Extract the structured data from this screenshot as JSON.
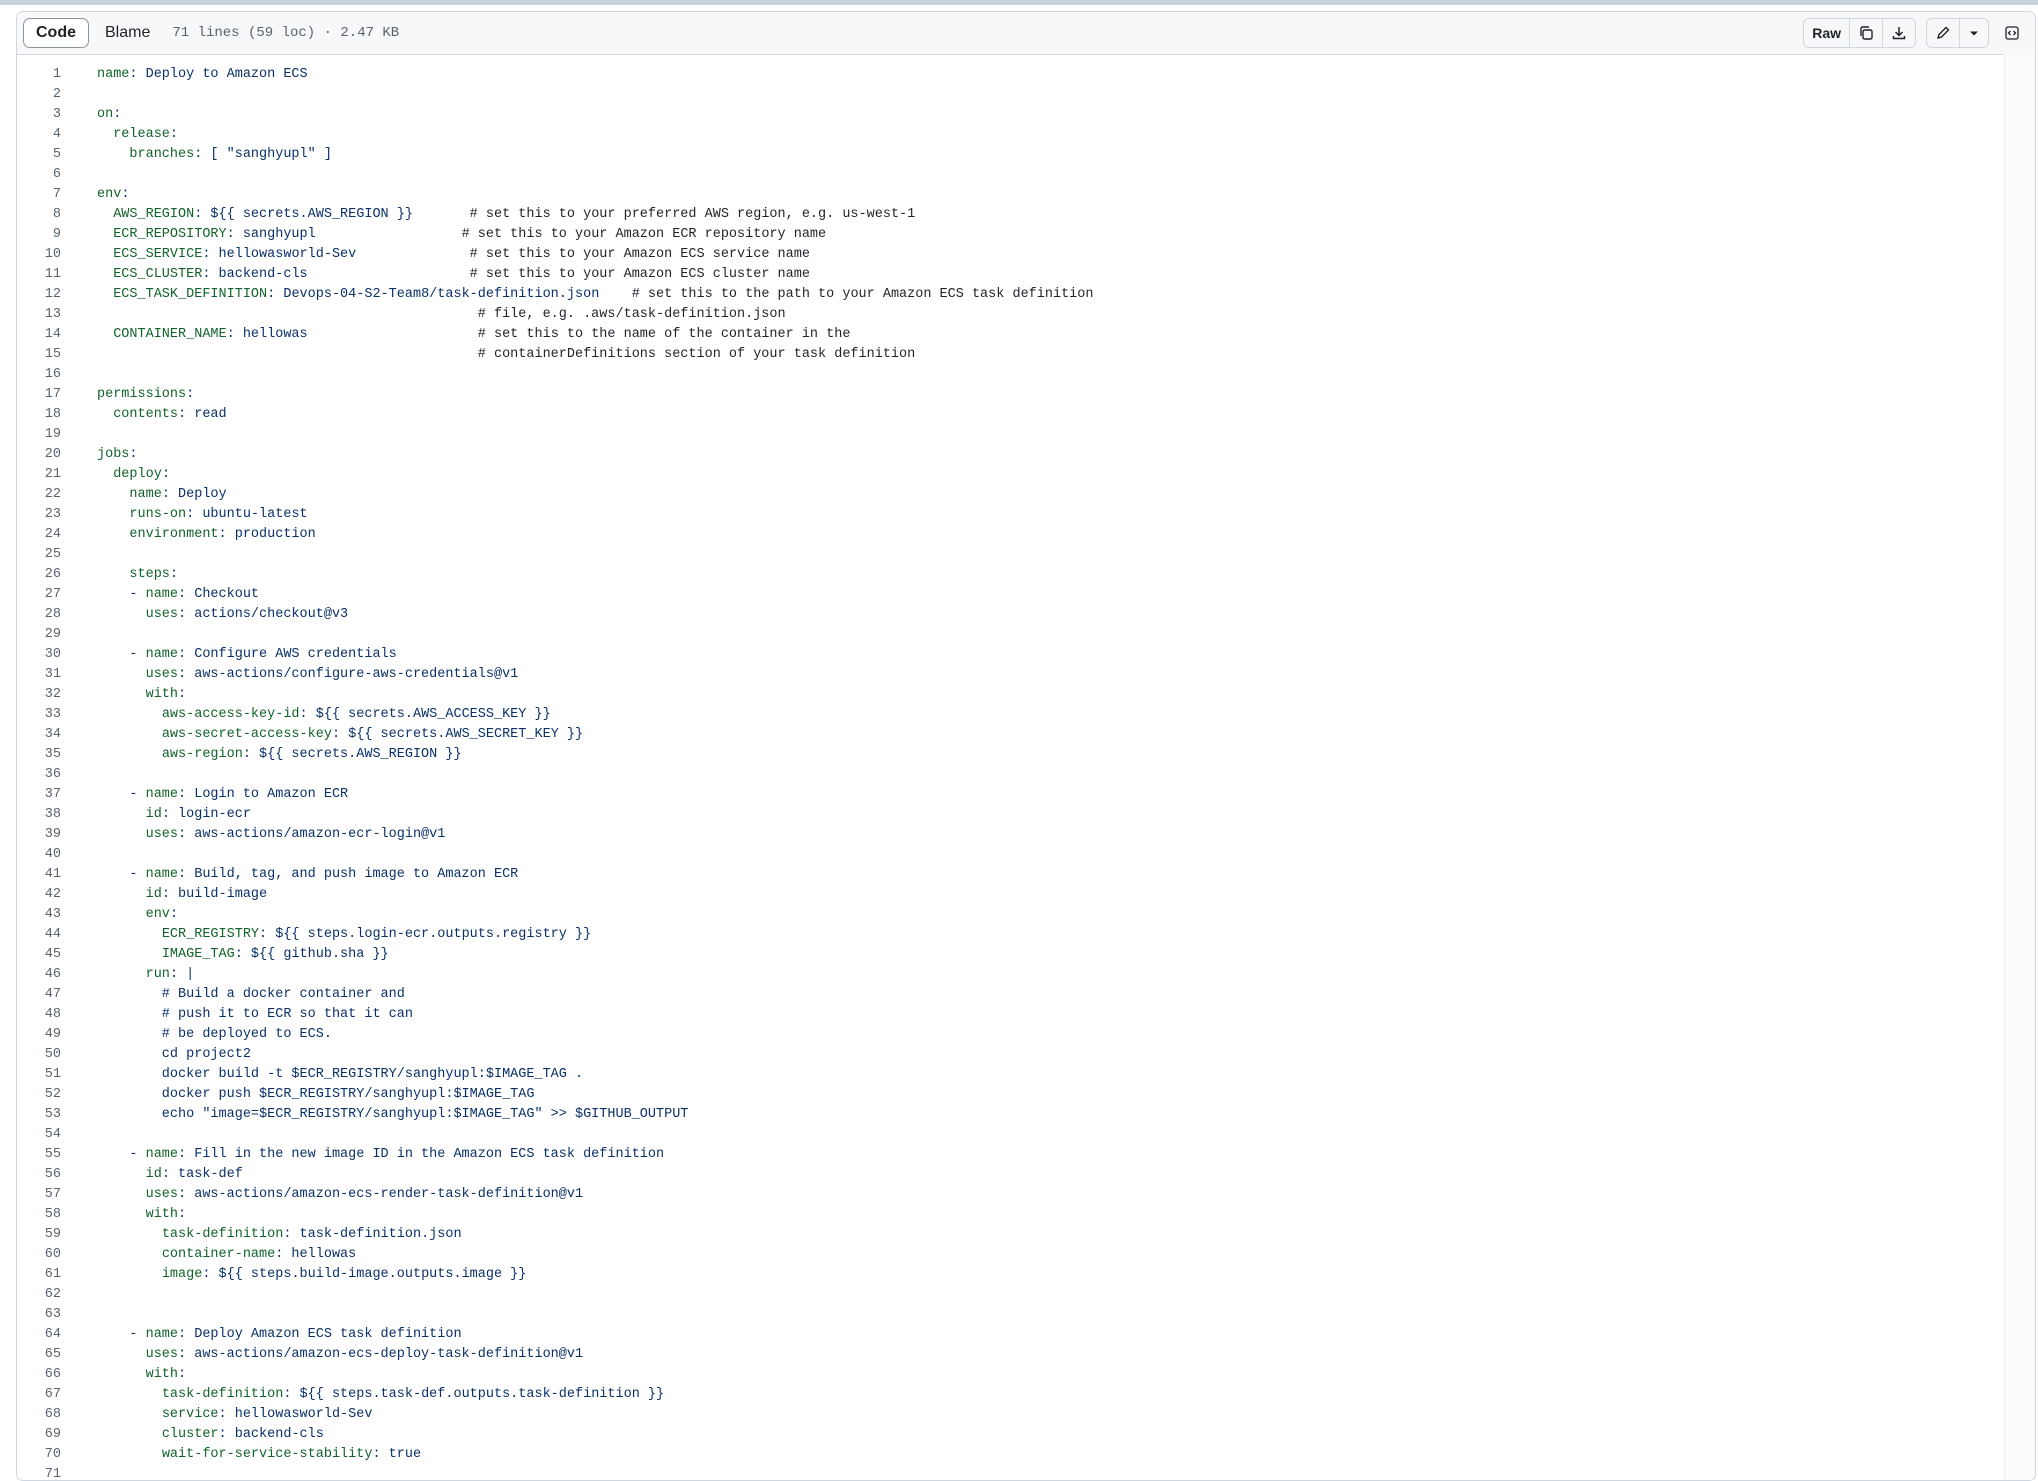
{
  "toolbar": {
    "code_tab": "Code",
    "blame_tab": "Blame",
    "file_info": "71 lines (59 loc) · 2.47 KB",
    "raw_label": "Raw",
    "icons": [
      "copy-icon",
      "download-icon",
      "pencil-icon",
      "chevron-down-icon",
      "symbols-panel-icon"
    ]
  },
  "colors": {
    "key": "#116329",
    "value": "#0a3069",
    "linenum": "#59636e",
    "comment": "#1f2328"
  },
  "lines": [
    [
      [
        "k",
        "name"
      ],
      [
        "v",
        ": Deploy to Amazon ECS"
      ]
    ],
    [],
    [
      [
        "k",
        "on"
      ],
      [
        "v",
        ":"
      ]
    ],
    [
      [
        "v",
        "  "
      ],
      [
        "k",
        "release"
      ],
      [
        "v",
        ":"
      ]
    ],
    [
      [
        "v",
        "    "
      ],
      [
        "k",
        "branches"
      ],
      [
        "v",
        ": [ \"sanghyupl\" ]"
      ]
    ],
    [],
    [
      [
        "k",
        "env"
      ],
      [
        "v",
        ":"
      ]
    ],
    [
      [
        "v",
        "  "
      ],
      [
        "k",
        "AWS_REGION"
      ],
      [
        "v",
        ": ${{ secrets.AWS_REGION }}       "
      ],
      [
        "c",
        "# set this to your preferred AWS region, e.g. us-west-1"
      ]
    ],
    [
      [
        "v",
        "  "
      ],
      [
        "k",
        "ECR_REPOSITORY"
      ],
      [
        "v",
        ": sanghyupl                  "
      ],
      [
        "c",
        "# set this to your Amazon ECR repository name"
      ]
    ],
    [
      [
        "v",
        "  "
      ],
      [
        "k",
        "ECS_SERVICE"
      ],
      [
        "v",
        ": hellowasworld-Sev              "
      ],
      [
        "c",
        "# set this to your Amazon ECS service name"
      ]
    ],
    [
      [
        "v",
        "  "
      ],
      [
        "k",
        "ECS_CLUSTER"
      ],
      [
        "v",
        ": backend-cls                    "
      ],
      [
        "c",
        "# set this to your Amazon ECS cluster name"
      ]
    ],
    [
      [
        "v",
        "  "
      ],
      [
        "k",
        "ECS_TASK_DEFINITION"
      ],
      [
        "v",
        ": Devops-04-S2-Team8/task-definition.json    "
      ],
      [
        "c",
        "# set this to the path to your Amazon ECS task definition"
      ]
    ],
    [
      [
        "v",
        "                                               "
      ],
      [
        "c",
        "# file, e.g. .aws/task-definition.json"
      ]
    ],
    [
      [
        "v",
        "  "
      ],
      [
        "k",
        "CONTAINER_NAME"
      ],
      [
        "v",
        ": hellowas                     "
      ],
      [
        "c",
        "# set this to the name of the container in the"
      ]
    ],
    [
      [
        "v",
        "                                               "
      ],
      [
        "c",
        "# containerDefinitions section of your task definition"
      ]
    ],
    [],
    [
      [
        "k",
        "permissions"
      ],
      [
        "v",
        ":"
      ]
    ],
    [
      [
        "v",
        "  "
      ],
      [
        "k",
        "contents"
      ],
      [
        "v",
        ": read"
      ]
    ],
    [],
    [
      [
        "k",
        "jobs"
      ],
      [
        "v",
        ":"
      ]
    ],
    [
      [
        "v",
        "  "
      ],
      [
        "k",
        "deploy"
      ],
      [
        "v",
        ":"
      ]
    ],
    [
      [
        "v",
        "    "
      ],
      [
        "k",
        "name"
      ],
      [
        "v",
        ": Deploy"
      ]
    ],
    [
      [
        "v",
        "    "
      ],
      [
        "k",
        "runs-on"
      ],
      [
        "v",
        ": ubuntu-latest"
      ]
    ],
    [
      [
        "v",
        "    "
      ],
      [
        "k",
        "environment"
      ],
      [
        "v",
        ": production"
      ]
    ],
    [],
    [
      [
        "v",
        "    "
      ],
      [
        "k",
        "steps"
      ],
      [
        "v",
        ":"
      ]
    ],
    [
      [
        "v",
        "    - "
      ],
      [
        "k",
        "name"
      ],
      [
        "v",
        ": Checkout"
      ]
    ],
    [
      [
        "v",
        "      "
      ],
      [
        "k",
        "uses"
      ],
      [
        "v",
        ": actions/checkout@v3"
      ]
    ],
    [],
    [
      [
        "v",
        "    - "
      ],
      [
        "k",
        "name"
      ],
      [
        "v",
        ": Configure AWS credentials"
      ]
    ],
    [
      [
        "v",
        "      "
      ],
      [
        "k",
        "uses"
      ],
      [
        "v",
        ": aws-actions/configure-aws-credentials@v1"
      ]
    ],
    [
      [
        "v",
        "      "
      ],
      [
        "k",
        "with"
      ],
      [
        "v",
        ":"
      ]
    ],
    [
      [
        "v",
        "        "
      ],
      [
        "k",
        "aws-access-key-id"
      ],
      [
        "v",
        ": ${{ secrets.AWS_ACCESS_KEY }}"
      ]
    ],
    [
      [
        "v",
        "        "
      ],
      [
        "k",
        "aws-secret-access-key"
      ],
      [
        "v",
        ": ${{ secrets.AWS_SECRET_KEY }}"
      ]
    ],
    [
      [
        "v",
        "        "
      ],
      [
        "k",
        "aws-region"
      ],
      [
        "v",
        ": ${{ secrets.AWS_REGION }}"
      ]
    ],
    [],
    [
      [
        "v",
        "    - "
      ],
      [
        "k",
        "name"
      ],
      [
        "v",
        ": Login to Amazon ECR"
      ]
    ],
    [
      [
        "v",
        "      "
      ],
      [
        "k",
        "id"
      ],
      [
        "v",
        ": login-ecr"
      ]
    ],
    [
      [
        "v",
        "      "
      ],
      [
        "k",
        "uses"
      ],
      [
        "v",
        ": aws-actions/amazon-ecr-login@v1"
      ]
    ],
    [],
    [
      [
        "v",
        "    - "
      ],
      [
        "k",
        "name"
      ],
      [
        "v",
        ": Build, tag, and push image to Amazon ECR"
      ]
    ],
    [
      [
        "v",
        "      "
      ],
      [
        "k",
        "id"
      ],
      [
        "v",
        ": build-image"
      ]
    ],
    [
      [
        "v",
        "      "
      ],
      [
        "k",
        "env"
      ],
      [
        "v",
        ":"
      ]
    ],
    [
      [
        "v",
        "        "
      ],
      [
        "k",
        "ECR_REGISTRY"
      ],
      [
        "v",
        ": ${{ steps.login-ecr.outputs.registry }}"
      ]
    ],
    [
      [
        "v",
        "        "
      ],
      [
        "k",
        "IMAGE_TAG"
      ],
      [
        "v",
        ": ${{ github.sha }}"
      ]
    ],
    [
      [
        "v",
        "      "
      ],
      [
        "k",
        "run"
      ],
      [
        "v",
        ": |"
      ]
    ],
    [
      [
        "v",
        "        # Build a docker container and"
      ]
    ],
    [
      [
        "v",
        "        # push it to ECR so that it can"
      ]
    ],
    [
      [
        "v",
        "        # be deployed to ECS."
      ]
    ],
    [
      [
        "v",
        "        cd project2"
      ]
    ],
    [
      [
        "v",
        "        docker build -t $ECR_REGISTRY/sanghyupl:$IMAGE_TAG ."
      ]
    ],
    [
      [
        "v",
        "        docker push $ECR_REGISTRY/sanghyupl:$IMAGE_TAG"
      ]
    ],
    [
      [
        "v",
        "        echo \"image=$ECR_REGISTRY/sanghyupl:$IMAGE_TAG\" >> $GITHUB_OUTPUT"
      ]
    ],
    [],
    [
      [
        "v",
        "    - "
      ],
      [
        "k",
        "name"
      ],
      [
        "v",
        ": Fill in the new image ID in the Amazon ECS task definition"
      ]
    ],
    [
      [
        "v",
        "      "
      ],
      [
        "k",
        "id"
      ],
      [
        "v",
        ": task-def"
      ]
    ],
    [
      [
        "v",
        "      "
      ],
      [
        "k",
        "uses"
      ],
      [
        "v",
        ": aws-actions/amazon-ecs-render-task-definition@v1"
      ]
    ],
    [
      [
        "v",
        "      "
      ],
      [
        "k",
        "with"
      ],
      [
        "v",
        ":"
      ]
    ],
    [
      [
        "v",
        "        "
      ],
      [
        "k",
        "task-definition"
      ],
      [
        "v",
        ": task-definition.json"
      ]
    ],
    [
      [
        "v",
        "        "
      ],
      [
        "k",
        "container-name"
      ],
      [
        "v",
        ": hellowas"
      ]
    ],
    [
      [
        "v",
        "        "
      ],
      [
        "k",
        "image"
      ],
      [
        "v",
        ": ${{ steps.build-image.outputs.image }}"
      ]
    ],
    [],
    [],
    [
      [
        "v",
        "    - "
      ],
      [
        "k",
        "name"
      ],
      [
        "v",
        ": Deploy Amazon ECS task definition"
      ]
    ],
    [
      [
        "v",
        "      "
      ],
      [
        "k",
        "uses"
      ],
      [
        "v",
        ": aws-actions/amazon-ecs-deploy-task-definition@v1"
      ]
    ],
    [
      [
        "v",
        "      "
      ],
      [
        "k",
        "with"
      ],
      [
        "v",
        ":"
      ]
    ],
    [
      [
        "v",
        "        "
      ],
      [
        "k",
        "task-definition"
      ],
      [
        "v",
        ": ${{ steps.task-def.outputs.task-definition }}"
      ]
    ],
    [
      [
        "v",
        "        "
      ],
      [
        "k",
        "service"
      ],
      [
        "v",
        ": hellowasworld-Sev"
      ]
    ],
    [
      [
        "v",
        "        "
      ],
      [
        "k",
        "cluster"
      ],
      [
        "v",
        ": backend-cls"
      ]
    ],
    [
      [
        "v",
        "        "
      ],
      [
        "k",
        "wait-for-service-stability"
      ],
      [
        "v",
        ": true"
      ]
    ],
    []
  ]
}
